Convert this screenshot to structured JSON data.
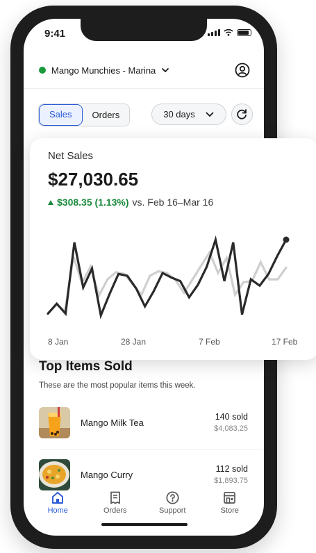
{
  "status_bar": {
    "time": "9:41"
  },
  "header": {
    "store_name": "Mango Munchies - Marina"
  },
  "controls": {
    "segments": [
      {
        "label": "Sales",
        "active": true
      },
      {
        "label": "Orders",
        "active": false
      }
    ],
    "range_label": "30 days"
  },
  "net_sales": {
    "label": "Net Sales",
    "value": "$27,030.65",
    "change": "$308.35 (1.13%)",
    "comparison": "vs. Feb 16–Mar 16"
  },
  "chart_data": {
    "type": "line",
    "x_tick_labels": [
      "8 Jan",
      "28 Jan",
      "7 Feb",
      "17 Feb"
    ],
    "series": [
      {
        "values": [
          2,
          12,
          5,
          65,
          36,
          54,
          22,
          40,
          48,
          46,
          34,
          23,
          44,
          49,
          47,
          39,
          25,
          40,
          55,
          70,
          47,
          64,
          23,
          37,
          38,
          59,
          40,
          40,
          53
        ]
      },
      {
        "values": [
          2,
          13,
          2,
          81,
          31,
          52,
          0,
          24,
          46,
          44,
          30,
          10,
          27,
          47,
          42,
          38,
          20,
          34,
          54,
          84,
          38,
          81,
          1,
          40,
          33,
          46,
          66,
          84
        ]
      }
    ]
  },
  "top_items": {
    "title": "Top Items Sold",
    "subtitle": "These are the most popular items this week.",
    "items": [
      {
        "name": "Mango Milk Tea",
        "sold": "140 sold",
        "revenue": "$4,083.25"
      },
      {
        "name": "Mango Curry",
        "sold": "112 sold",
        "revenue": "$1,893.75"
      }
    ]
  },
  "tabs": [
    {
      "label": "Home",
      "icon": "home-icon",
      "active": true
    },
    {
      "label": "Orders",
      "icon": "receipt-icon",
      "active": false
    },
    {
      "label": "Support",
      "icon": "help-icon",
      "active": false
    },
    {
      "label": "Store",
      "icon": "store-icon",
      "active": false
    }
  ],
  "colors": {
    "accent": "#2b5bd7",
    "positive": "#1a8a3c",
    "status_dot": "#1a9a3a"
  }
}
